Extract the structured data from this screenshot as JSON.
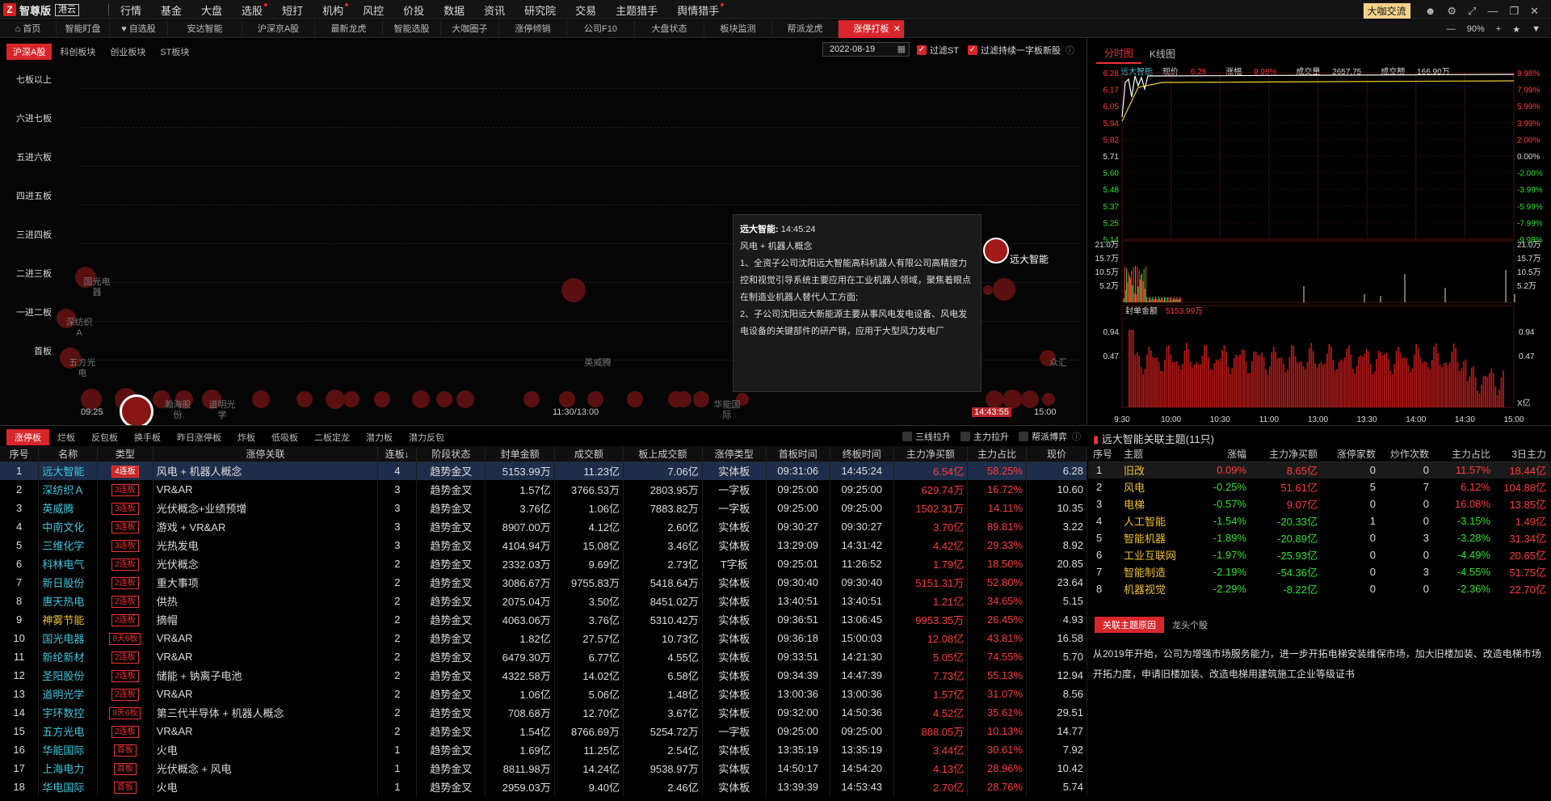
{
  "app": {
    "logo": "Z",
    "name": "智尊版",
    "edition": "港云"
  },
  "menu": [
    {
      "label": "行情",
      "dot": false
    },
    {
      "label": "基金",
      "dot": false
    },
    {
      "label": "大盘",
      "dot": false
    },
    {
      "label": "选股",
      "dot": true
    },
    {
      "label": "短打",
      "dot": false
    },
    {
      "label": "机构",
      "dot": true
    },
    {
      "label": "风控",
      "dot": false
    },
    {
      "label": "价投",
      "dot": false
    },
    {
      "label": "数据",
      "dot": false
    },
    {
      "label": "资讯",
      "dot": false
    },
    {
      "label": "研究院",
      "dot": false
    },
    {
      "label": "交易",
      "dot": false
    },
    {
      "label": "主题猎手",
      "dot": false
    },
    {
      "label": "舆情猎手",
      "dot": true
    }
  ],
  "menu_right": {
    "community_button": "大咖交流"
  },
  "tabs": [
    "首页",
    "智能盯盘",
    "自选股",
    "安达智能",
    "沪深京A股",
    "最新龙虎",
    "智能选股",
    "大咖圈子",
    "涨停倾销",
    "公司F10",
    "大盘状态",
    "板块监测",
    "帮派龙虎",
    "涨停打板"
  ],
  "active_tab": "涨停打板",
  "zoom": "90%",
  "board": {
    "subtabs": [
      "沪深A股",
      "科创板块",
      "创业板块",
      "ST板块"
    ],
    "date": "2022-08-19",
    "filter_st": "过滤ST",
    "filter_new": "过滤持续一字板新股",
    "levels": [
      "七板以上",
      "六进七板",
      "五进六板",
      "四进五板",
      "三进四板",
      "二进三板",
      "一进二板",
      "首板"
    ],
    "time_start": "09:25",
    "time_mid": "11:30/13:00",
    "time_cursor": "14:43:55",
    "time_end": "15:00",
    "highlight_stock": "远大智能",
    "labels": [
      "深纺织A",
      "五方光电",
      "英威腾",
      "众汇",
      "瀚海股份",
      "道明光学",
      "华能国际",
      "国光电器"
    ]
  },
  "tooltip": {
    "title": "远大智能:",
    "time": "14:45:24",
    "concept": "风电 + 机器人概念",
    "p1": "1、全资子公司沈阳远大智能高科机器人有限公司高精度力控和视觉引导系统主要应用在工业机器人领域，聚焦着眼点在制造业机器人替代人工方面;",
    "p2": "2、子公司沈阳远大新能源主要从事风电发电设备、风电发电设备的关键部件的研产销，应用于大型风力发电厂"
  },
  "chart": {
    "tabs": [
      "分时图",
      "K线图"
    ],
    "stock": "远大智能",
    "price_label": "现价",
    "price": "6.28",
    "change_label": "涨幅",
    "change": "9.98%",
    "volume_label": "成交量",
    "volume": "2657.75",
    "amount_label": "成交额",
    "amount": "166.90万",
    "price_axis": [
      "6.28",
      "6.17",
      "6.05",
      "5.94",
      "5.82",
      "5.71",
      "5.60",
      "5.48",
      "5.37",
      "5.25",
      "5.14"
    ],
    "pct_axis": [
      "9.98%",
      "7.99%",
      "5.99%",
      "3.99%",
      "2.00%",
      "0.00%",
      "-2.00%",
      "-3.99%",
      "-5.99%",
      "-7.99%",
      "-9.98%"
    ],
    "vol_axis": [
      "21.0万",
      "15.7万",
      "10.5万",
      "5.2万"
    ],
    "seal_label": "封单金额",
    "seal_value": "5153.99万",
    "seal_axis": [
      "0.94",
      "0.47"
    ],
    "seal_unit": "X亿",
    "time_axis": [
      "9:30",
      "10:00",
      "10:30",
      "11:00",
      "13:00",
      "13:30",
      "14:00",
      "14:30",
      "15:00"
    ]
  },
  "lower": {
    "tabs": [
      "涨停板",
      "烂板",
      "反包板",
      "换手板",
      "昨日涨停板",
      "炸板",
      "低吸板",
      "二板定龙",
      "潜力板",
      "潜力反包"
    ],
    "filters": [
      "三线拉升",
      "主力拉升",
      "帮派博弈"
    ],
    "columns": [
      "序号",
      "名称",
      "类型",
      "涨停关联",
      "连板↓",
      "阶段状态",
      "封单金额",
      "成交额",
      "板上成交额",
      "涨停类型",
      "首板时间",
      "终板时间",
      "主力净买额",
      "主力占比",
      "现价"
    ],
    "rows": [
      {
        "idx": "1",
        "name": "远大智能",
        "type": "4连板",
        "solid": true,
        "reason": "风电 + 机器人概念",
        "boards": "4",
        "stage": "趋势金叉",
        "seal": "5153.99万",
        "amount": "11.23亿",
        "onboard": "7.06亿",
        "ztype": "实体板",
        "first": "09:31:06",
        "last": "14:45:24",
        "net": "6.54亿",
        "ratio": "58.25%",
        "price": "6.28",
        "gold": false
      },
      {
        "idx": "2",
        "name": "深纺织Ａ",
        "type": "3连板",
        "solid": false,
        "reason": "VR&AR",
        "boards": "3",
        "stage": "趋势金叉",
        "seal": "1.57亿",
        "amount": "3766.53万",
        "onboard": "2803.95万",
        "ztype": "一字板",
        "first": "09:25:00",
        "last": "09:25:00",
        "net": "629.74万",
        "ratio": "16.72%",
        "price": "10.60",
        "gold": false
      },
      {
        "idx": "3",
        "name": "英威腾",
        "type": "3连板",
        "solid": false,
        "reason": "光伏概念+业绩预增",
        "boards": "3",
        "stage": "趋势金叉",
        "seal": "3.76亿",
        "amount": "1.06亿",
        "onboard": "7883.82万",
        "ztype": "一字板",
        "first": "09:25:00",
        "last": "09:25:00",
        "net": "1502.31万",
        "ratio": "14.11%",
        "price": "10.35",
        "gold": false
      },
      {
        "idx": "4",
        "name": "中南文化",
        "type": "3连板",
        "solid": false,
        "reason": "游戏 + VR&AR",
        "boards": "3",
        "stage": "趋势金叉",
        "seal": "8907.00万",
        "amount": "4.12亿",
        "onboard": "2.60亿",
        "ztype": "实体板",
        "first": "09:30:27",
        "last": "09:30:27",
        "net": "3.70亿",
        "ratio": "89.81%",
        "price": "3.22",
        "gold": false
      },
      {
        "idx": "5",
        "name": "三维化学",
        "type": "3连板",
        "solid": false,
        "reason": "光热发电",
        "boards": "3",
        "stage": "趋势金叉",
        "seal": "4104.94万",
        "amount": "15.08亿",
        "onboard": "3.46亿",
        "ztype": "实体板",
        "first": "13:29:09",
        "last": "14:31:42",
        "net": "4.42亿",
        "ratio": "29.33%",
        "price": "8.92",
        "gold": false
      },
      {
        "idx": "6",
        "name": "科林电气",
        "type": "2连板",
        "solid": false,
        "reason": "光伏概念",
        "boards": "2",
        "stage": "趋势金叉",
        "seal": "2332.03万",
        "amount": "9.69亿",
        "onboard": "2.73亿",
        "ztype": "T字板",
        "first": "09:25:01",
        "last": "11:26:52",
        "net": "1.79亿",
        "ratio": "18.50%",
        "price": "20.85",
        "gold": false
      },
      {
        "idx": "7",
        "name": "新日股份",
        "type": "2连板",
        "solid": false,
        "reason": "重大事项",
        "boards": "2",
        "stage": "趋势金叉",
        "seal": "3086.67万",
        "amount": "9755.83万",
        "onboard": "5418.64万",
        "ztype": "实体板",
        "first": "09:30:40",
        "last": "09:30:40",
        "net": "5151.31万",
        "ratio": "52.80%",
        "price": "23.64",
        "gold": false
      },
      {
        "idx": "8",
        "name": "惠天热电",
        "type": "2连板",
        "solid": false,
        "reason": "供热",
        "boards": "2",
        "stage": "趋势金叉",
        "seal": "2075.04万",
        "amount": "3.50亿",
        "onboard": "8451.02万",
        "ztype": "实体板",
        "first": "13:40:51",
        "last": "13:40:51",
        "net": "1.21亿",
        "ratio": "34.65%",
        "price": "5.15",
        "gold": false
      },
      {
        "idx": "9",
        "name": "神雾节能",
        "type": "2连板",
        "solid": false,
        "reason": "摘帽",
        "boards": "2",
        "stage": "趋势金叉",
        "seal": "4063.06万",
        "amount": "3.76亿",
        "onboard": "5310.42万",
        "ztype": "实体板",
        "first": "09:36:51",
        "last": "13:06:45",
        "net": "9953.35万",
        "ratio": "26.45%",
        "price": "4.93",
        "gold": true
      },
      {
        "idx": "10",
        "name": "国光电器",
        "type": "8天6板",
        "solid": false,
        "reason": "VR&AR",
        "boards": "2",
        "stage": "趋势金叉",
        "seal": "1.82亿",
        "amount": "27.57亿",
        "onboard": "10.73亿",
        "ztype": "实体板",
        "first": "09:36:18",
        "last": "15:00:03",
        "net": "12.08亿",
        "ratio": "43.81%",
        "price": "16.58",
        "gold": false
      },
      {
        "idx": "11",
        "name": "新纶新材",
        "type": "2连板",
        "solid": false,
        "reason": "VR&AR",
        "boards": "2",
        "stage": "趋势金叉",
        "seal": "6479.30万",
        "amount": "6.77亿",
        "onboard": "4.55亿",
        "ztype": "实体板",
        "first": "09:33:51",
        "last": "14:21:30",
        "net": "5.05亿",
        "ratio": "74.55%",
        "price": "5.70",
        "gold": false
      },
      {
        "idx": "12",
        "name": "圣阳股份",
        "type": "2连板",
        "solid": false,
        "reason": "储能 + 钠离子电池",
        "boards": "2",
        "stage": "趋势金叉",
        "seal": "4322.58万",
        "amount": "14.02亿",
        "onboard": "6.58亿",
        "ztype": "实体板",
        "first": "09:34:39",
        "last": "14:47:39",
        "net": "7.73亿",
        "ratio": "55.13%",
        "price": "12.94",
        "gold": false
      },
      {
        "idx": "13",
        "name": "道明光学",
        "type": "2连板",
        "solid": false,
        "reason": "VR&AR",
        "boards": "2",
        "stage": "趋势金叉",
        "seal": "1.06亿",
        "amount": "5.06亿",
        "onboard": "1.48亿",
        "ztype": "实体板",
        "first": "13:00:36",
        "last": "13:00:36",
        "net": "1.57亿",
        "ratio": "31.07%",
        "price": "8.56",
        "gold": false
      },
      {
        "idx": "14",
        "name": "宇环数控",
        "type": "8天6板",
        "solid": false,
        "reason": "第三代半导体 + 机器人概念",
        "boards": "2",
        "stage": "趋势金叉",
        "seal": "708.68万",
        "amount": "12.70亿",
        "onboard": "3.67亿",
        "ztype": "实体板",
        "first": "09:32:00",
        "last": "14:50:36",
        "net": "4.52亿",
        "ratio": "35.61%",
        "price": "29.51",
        "gold": false
      },
      {
        "idx": "15",
        "name": "五方光电",
        "type": "2连板",
        "solid": false,
        "reason": "VR&AR",
        "boards": "2",
        "stage": "趋势金叉",
        "seal": "1.54亿",
        "amount": "8766.69万",
        "onboard": "5254.72万",
        "ztype": "一字板",
        "first": "09:25:00",
        "last": "09:25:00",
        "net": "888.05万",
        "ratio": "10.13%",
        "price": "14.77",
        "gold": false
      },
      {
        "idx": "16",
        "name": "华能国际",
        "type": "首板",
        "solid": false,
        "reason": "火电",
        "boards": "1",
        "stage": "趋势金叉",
        "seal": "1.69亿",
        "amount": "11.25亿",
        "onboard": "2.54亿",
        "ztype": "实体板",
        "first": "13:35:19",
        "last": "13:35:19",
        "net": "3.44亿",
        "ratio": "30.61%",
        "price": "7.92",
        "gold": false
      },
      {
        "idx": "17",
        "name": "上海电力",
        "type": "首板",
        "solid": false,
        "reason": "光伏概念 + 风电",
        "boards": "1",
        "stage": "趋势金叉",
        "seal": "8811.98万",
        "amount": "14.24亿",
        "onboard": "9538.97万",
        "ztype": "实体板",
        "first": "14:50:17",
        "last": "14:54:20",
        "net": "4.13亿",
        "ratio": "28.96%",
        "price": "10.42",
        "gold": false
      },
      {
        "idx": "18",
        "name": "华电国际",
        "type": "首板",
        "solid": false,
        "reason": "火电",
        "boards": "1",
        "stage": "趋势金叉",
        "seal": "2959.03万",
        "amount": "9.40亿",
        "onboard": "2.46亿",
        "ztype": "实体板",
        "first": "13:39:39",
        "last": "14:53:43",
        "net": "2.70亿",
        "ratio": "28.76%",
        "price": "5.74",
        "gold": false
      }
    ]
  },
  "themes": {
    "title": "远大智能关联主题(11只)",
    "columns": [
      "序号",
      "主题",
      "涨幅",
      "主力净买额",
      "涨停家数",
      "炒作次数",
      "主力占比",
      "3日主力"
    ],
    "rows": [
      {
        "idx": "1",
        "name": "旧改",
        "chg": "0.09%",
        "net": "8.65亿",
        "zt": "0",
        "times": "0",
        "ratio": "11.57%",
        "d3": "18.44亿",
        "chg_red": true,
        "net_red": true,
        "ratio_red": true,
        "d3_red": true
      },
      {
        "idx": "2",
        "name": "风电",
        "chg": "-0.25%",
        "net": "51.61亿",
        "zt": "5",
        "times": "7",
        "ratio": "6.12%",
        "d3": "104.88亿",
        "chg_red": false,
        "net_red": true,
        "ratio_red": true,
        "d3_red": true
      },
      {
        "idx": "3",
        "name": "电梯",
        "chg": "-0.57%",
        "net": "9.07亿",
        "zt": "0",
        "times": "0",
        "ratio": "16.08%",
        "d3": "13.85亿",
        "chg_red": false,
        "net_red": true,
        "ratio_red": true,
        "d3_red": true
      },
      {
        "idx": "4",
        "name": "人工智能",
        "chg": "-1.54%",
        "net": "-20.33亿",
        "zt": "1",
        "times": "0",
        "ratio": "-3.15%",
        "d3": "1.49亿",
        "chg_red": false,
        "net_red": false,
        "ratio_red": false,
        "d3_red": true
      },
      {
        "idx": "5",
        "name": "智能机器",
        "chg": "-1.89%",
        "net": "-20.89亿",
        "zt": "0",
        "times": "3",
        "ratio": "-3.28%",
        "d3": "31.34亿",
        "chg_red": false,
        "net_red": false,
        "ratio_red": false,
        "d3_red": true
      },
      {
        "idx": "6",
        "name": "工业互联网",
        "chg": "-1.97%",
        "net": "-25.93亿",
        "zt": "0",
        "times": "0",
        "ratio": "-4.49%",
        "d3": "20.65亿",
        "chg_red": false,
        "net_red": false,
        "ratio_red": false,
        "d3_red": true
      },
      {
        "idx": "7",
        "name": "智能制造",
        "chg": "-2.19%",
        "net": "-54.36亿",
        "zt": "0",
        "times": "3",
        "ratio": "-4.55%",
        "d3": "51.75亿",
        "chg_red": false,
        "net_red": false,
        "ratio_red": false,
        "d3_red": true
      },
      {
        "idx": "8",
        "name": "机器视觉",
        "chg": "-2.29%",
        "net": "-8.22亿",
        "zt": "0",
        "times": "0",
        "ratio": "-2.36%",
        "d3": "22.70亿",
        "chg_red": false,
        "net_red": false,
        "ratio_red": false,
        "d3_red": true
      }
    ],
    "reason_tabs": [
      "关联主题原因",
      "龙头个股"
    ],
    "reason": "从2019年开始，公司为增强市场服务能力，进一步开拓电梯安装维保市场，加大旧楼加装、改造电梯市场开拓力度，申请旧楼加装、改造电梯用建筑施工企业等级证书"
  }
}
